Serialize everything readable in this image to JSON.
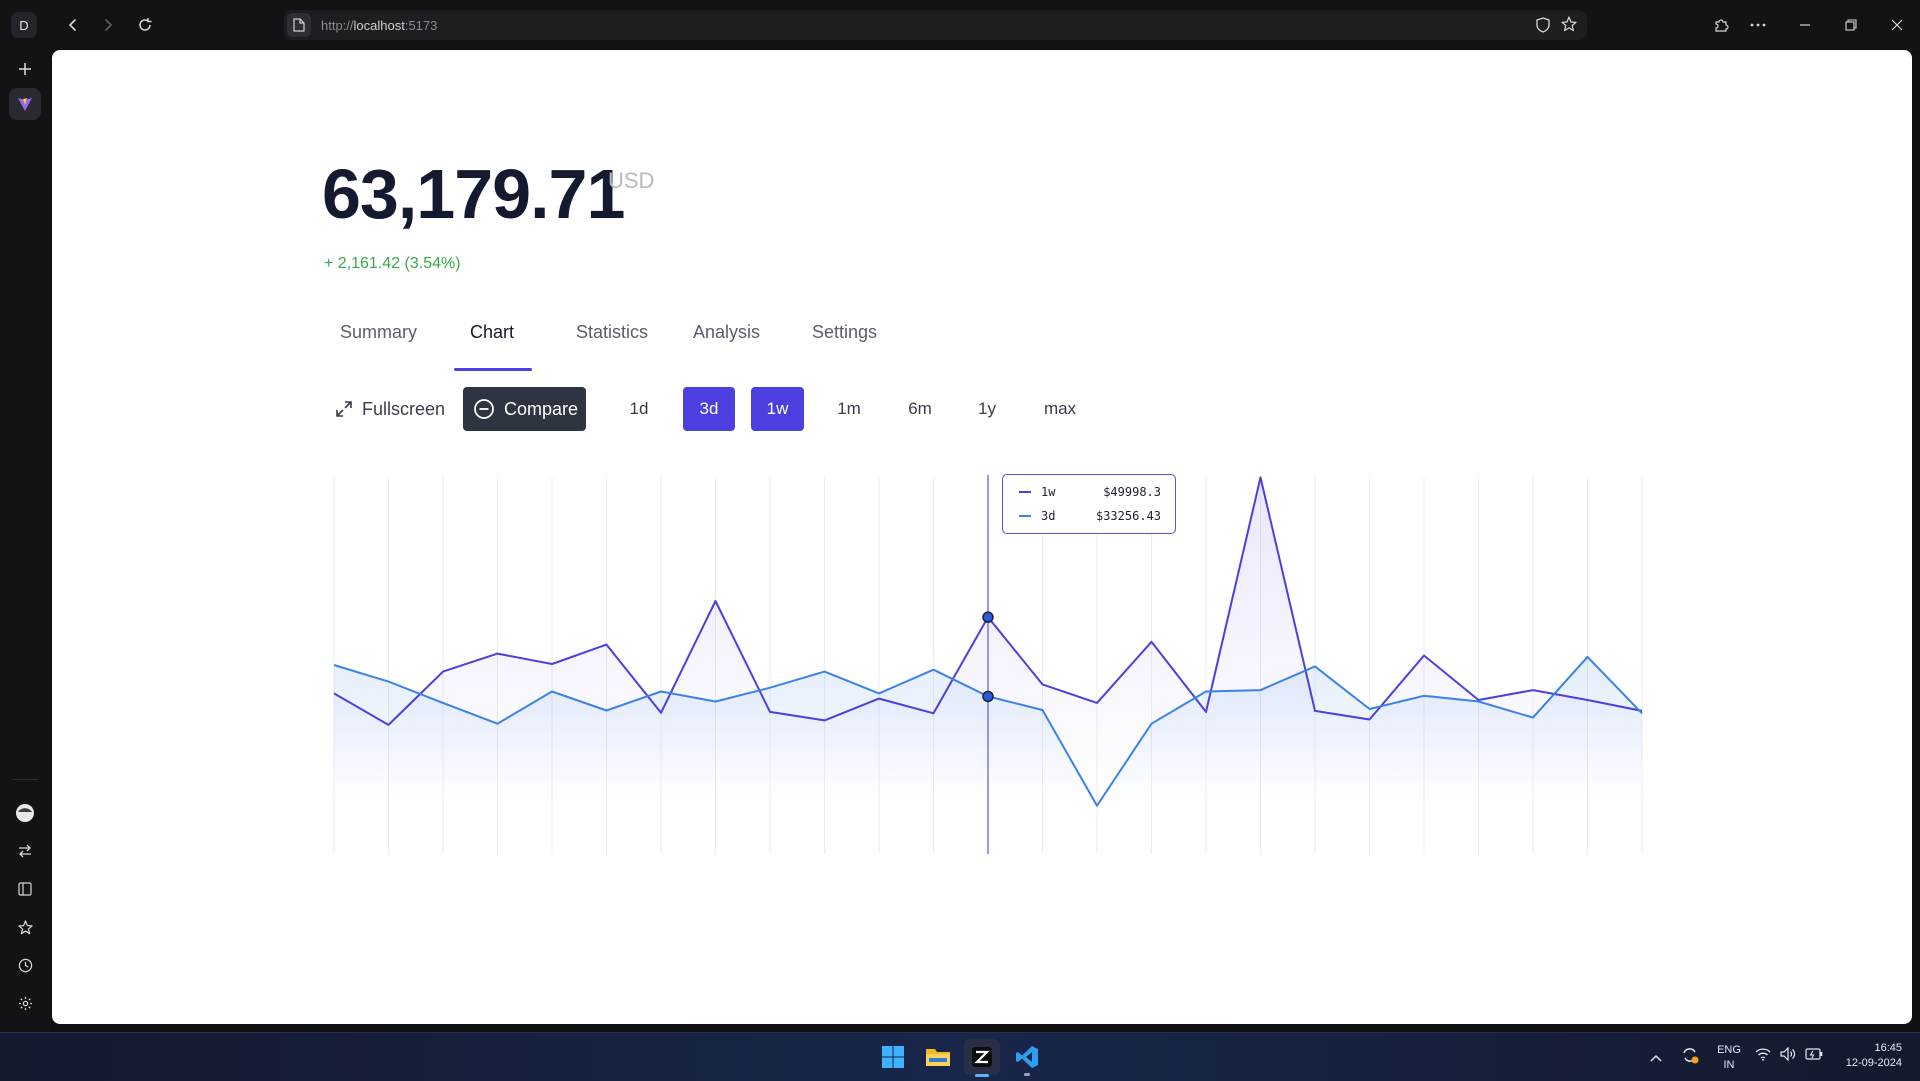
{
  "browser": {
    "profile_initial": "D",
    "url_scheme": "http://",
    "url_host": "localhost",
    "url_port": ":5173"
  },
  "ticker": {
    "price": "63,179.71",
    "currency": "USD",
    "change": "+ 2,161.42 (3.54%)"
  },
  "tabs": [
    {
      "label": "Summary"
    },
    {
      "label": "Chart",
      "active": true
    },
    {
      "label": "Statistics"
    },
    {
      "label": "Analysis"
    },
    {
      "label": "Settings"
    }
  ],
  "toolbar": {
    "fullscreen_label": "Fullscreen",
    "compare_label": "Compare",
    "ranges": [
      {
        "label": "1d",
        "selected": false
      },
      {
        "label": "3d",
        "selected": true
      },
      {
        "label": "1w",
        "selected": true
      },
      {
        "label": "1m",
        "selected": false
      },
      {
        "label": "6m",
        "selected": false
      },
      {
        "label": "1y",
        "selected": false
      },
      {
        "label": "max",
        "selected": false
      }
    ]
  },
  "colors": {
    "accent": "#4b3fe0",
    "series_1w": "#4b3fe0",
    "series_3d": "#3b82e8",
    "positive": "#3aa84b"
  },
  "chart_data": {
    "type": "line",
    "grid": "vertical",
    "hover_index": 12,
    "x": [
      0,
      1,
      2,
      3,
      4,
      5,
      6,
      7,
      8,
      9,
      10,
      11,
      12,
      13,
      14,
      15,
      16,
      17,
      18,
      19,
      20,
      21,
      22,
      23,
      24
    ],
    "series": [
      {
        "name": "1w",
        "values": [
          33900,
          27250,
          38500,
          42300,
          40100,
          44200,
          29800,
          53400,
          30000,
          28200,
          32800,
          29700,
          49998.3,
          35800,
          31900,
          44800,
          30000,
          79500,
          30200,
          28400,
          41900,
          32500,
          34600,
          32500,
          30200
        ]
      },
      {
        "name": "3d",
        "values": [
          39900,
          36400,
          31900,
          27500,
          34300,
          30300,
          34300,
          32200,
          35100,
          38500,
          33900,
          38900,
          33256.43,
          30400,
          10200,
          27500,
          34300,
          34600,
          39600,
          30600,
          33400,
          32200,
          28800,
          41600,
          29700
        ]
      }
    ],
    "tooltip": [
      {
        "name": "1w",
        "value": "$49998.3"
      },
      {
        "name": "3d",
        "value": "$33256.43"
      }
    ]
  },
  "taskbar": {
    "apps": [
      "windows-start",
      "file-explorer",
      "zed-editor",
      "vscode"
    ],
    "lang_line1": "ENG",
    "lang_line2": "IN",
    "time": "16:45",
    "date": "12-09-2024"
  }
}
